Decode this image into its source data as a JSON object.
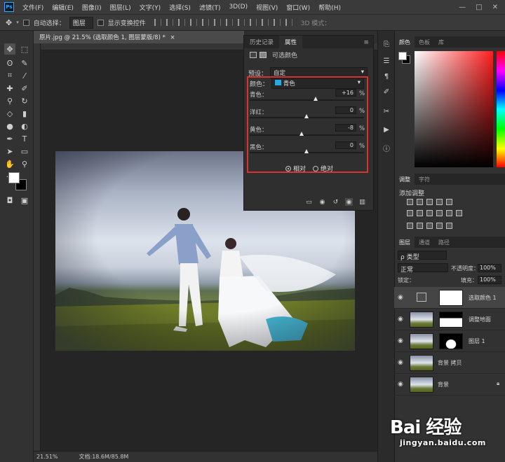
{
  "menubar": {
    "app_badge": "Ps",
    "items": [
      "文件(F)",
      "编辑(E)",
      "图像(I)",
      "图层(L)",
      "文字(Y)",
      "选择(S)",
      "滤镜(T)",
      "3D(D)",
      "视图(V)",
      "窗口(W)",
      "帮助(H)"
    ],
    "window_controls": [
      "—",
      "□",
      "✕"
    ]
  },
  "options_bar": {
    "auto_select_label": "自动选择：",
    "auto_select_value": "图层",
    "show_transform_label": "显示变换控件",
    "mode_3d_label": "3D 模式："
  },
  "document": {
    "tab_title": "原片.jpg @ 21.5% (选取颜色 1, 图层蒙版/8) *",
    "tab_close": "×",
    "zoom": "21.51%",
    "doc_size": "文档:18.6M/85.8M"
  },
  "properties_panel": {
    "tabs": [
      "历史记录",
      "属性"
    ],
    "active_tab": "属性",
    "menu_glyph": "≡",
    "header_label": "可选颜色",
    "preset_label": "预设：",
    "preset_value": "自定",
    "colors_label": "颜色：",
    "colors_value": "青色",
    "colors_swatch": "#29a9e1",
    "sliders": [
      {
        "label": "青色：",
        "value": "+16",
        "unit": "%",
        "position": 0.58
      },
      {
        "label": "洋红：",
        "value": "0",
        "unit": "%",
        "position": 0.5
      },
      {
        "label": "黄色：",
        "value": "-8",
        "unit": "%",
        "position": 0.46
      },
      {
        "label": "黑色：",
        "value": "0",
        "unit": "%",
        "position": 0.5
      }
    ],
    "method_relative": "相对",
    "method_absolute": "绝对",
    "selected_method": "相对",
    "highlight_color": "#d8342d"
  },
  "right_panels": {
    "color_tabs": [
      "颜色",
      "色板",
      "库"
    ],
    "adjust_tabs": [
      "调整",
      "字符"
    ],
    "add_adjustment_label": "添加调整",
    "layers_tabs": [
      "图层",
      "通道",
      "路径"
    ],
    "filter_label": "ρ 类型",
    "blend_mode": "正常",
    "opacity_label": "不透明度：",
    "opacity_value": "100%",
    "lock_label": "锁定：",
    "fill_label": "填充：",
    "fill_value": "100%",
    "foreground_color": "#ffffff",
    "background_color": "#000000"
  },
  "layers": [
    {
      "name": "选取颜色 1",
      "kind": "adjustment",
      "selected": true
    },
    {
      "name": "调整地面",
      "kind": "masked",
      "selected": false
    },
    {
      "name": "图层 1",
      "kind": "masked",
      "selected": false
    },
    {
      "name": "背景 拷贝",
      "kind": "image",
      "selected": false
    },
    {
      "name": "背景",
      "kind": "image",
      "selected": false,
      "locked": true
    }
  ],
  "watermark": {
    "brand": "Bai 经验",
    "url": "jingyan.baidu.com"
  }
}
